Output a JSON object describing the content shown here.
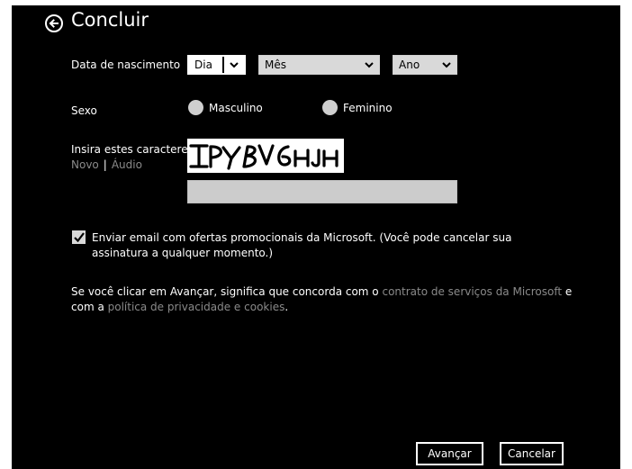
{
  "header": {
    "title": "Concluir",
    "back_icon": "back-arrow-icon"
  },
  "birthdate": {
    "label": "Data de nascimento",
    "day": "Dia",
    "month": "Mês",
    "year": "Ano"
  },
  "sex": {
    "label": "Sexo",
    "options": [
      "Masculino",
      "Feminino"
    ]
  },
  "captcha": {
    "label": "Insira estes caracteres",
    "new_link": "Novo",
    "separator": "|",
    "audio_link": "Áudio",
    "image_text": "IPYBV6HJH",
    "input_value": ""
  },
  "offers": {
    "checked": true,
    "text": "Enviar email com ofertas promocionais da Microsoft. (Você pode cancelar sua assinatura a qualquer momento.)"
  },
  "terms": {
    "prefix": "Se você clicar em Avançar, significa que concorda com o ",
    "service_link": "contrato de serviços da Microsoft",
    "middle": " e com a ",
    "privacy_link": "política de privacidade e cookies",
    "suffix": "."
  },
  "buttons": {
    "next": "Avançar",
    "cancel": "Cancelar"
  },
  "colors": {
    "background": "#000000",
    "text": "#ffffff",
    "link": "#8a8a8a",
    "field": "#d9d9d9"
  }
}
